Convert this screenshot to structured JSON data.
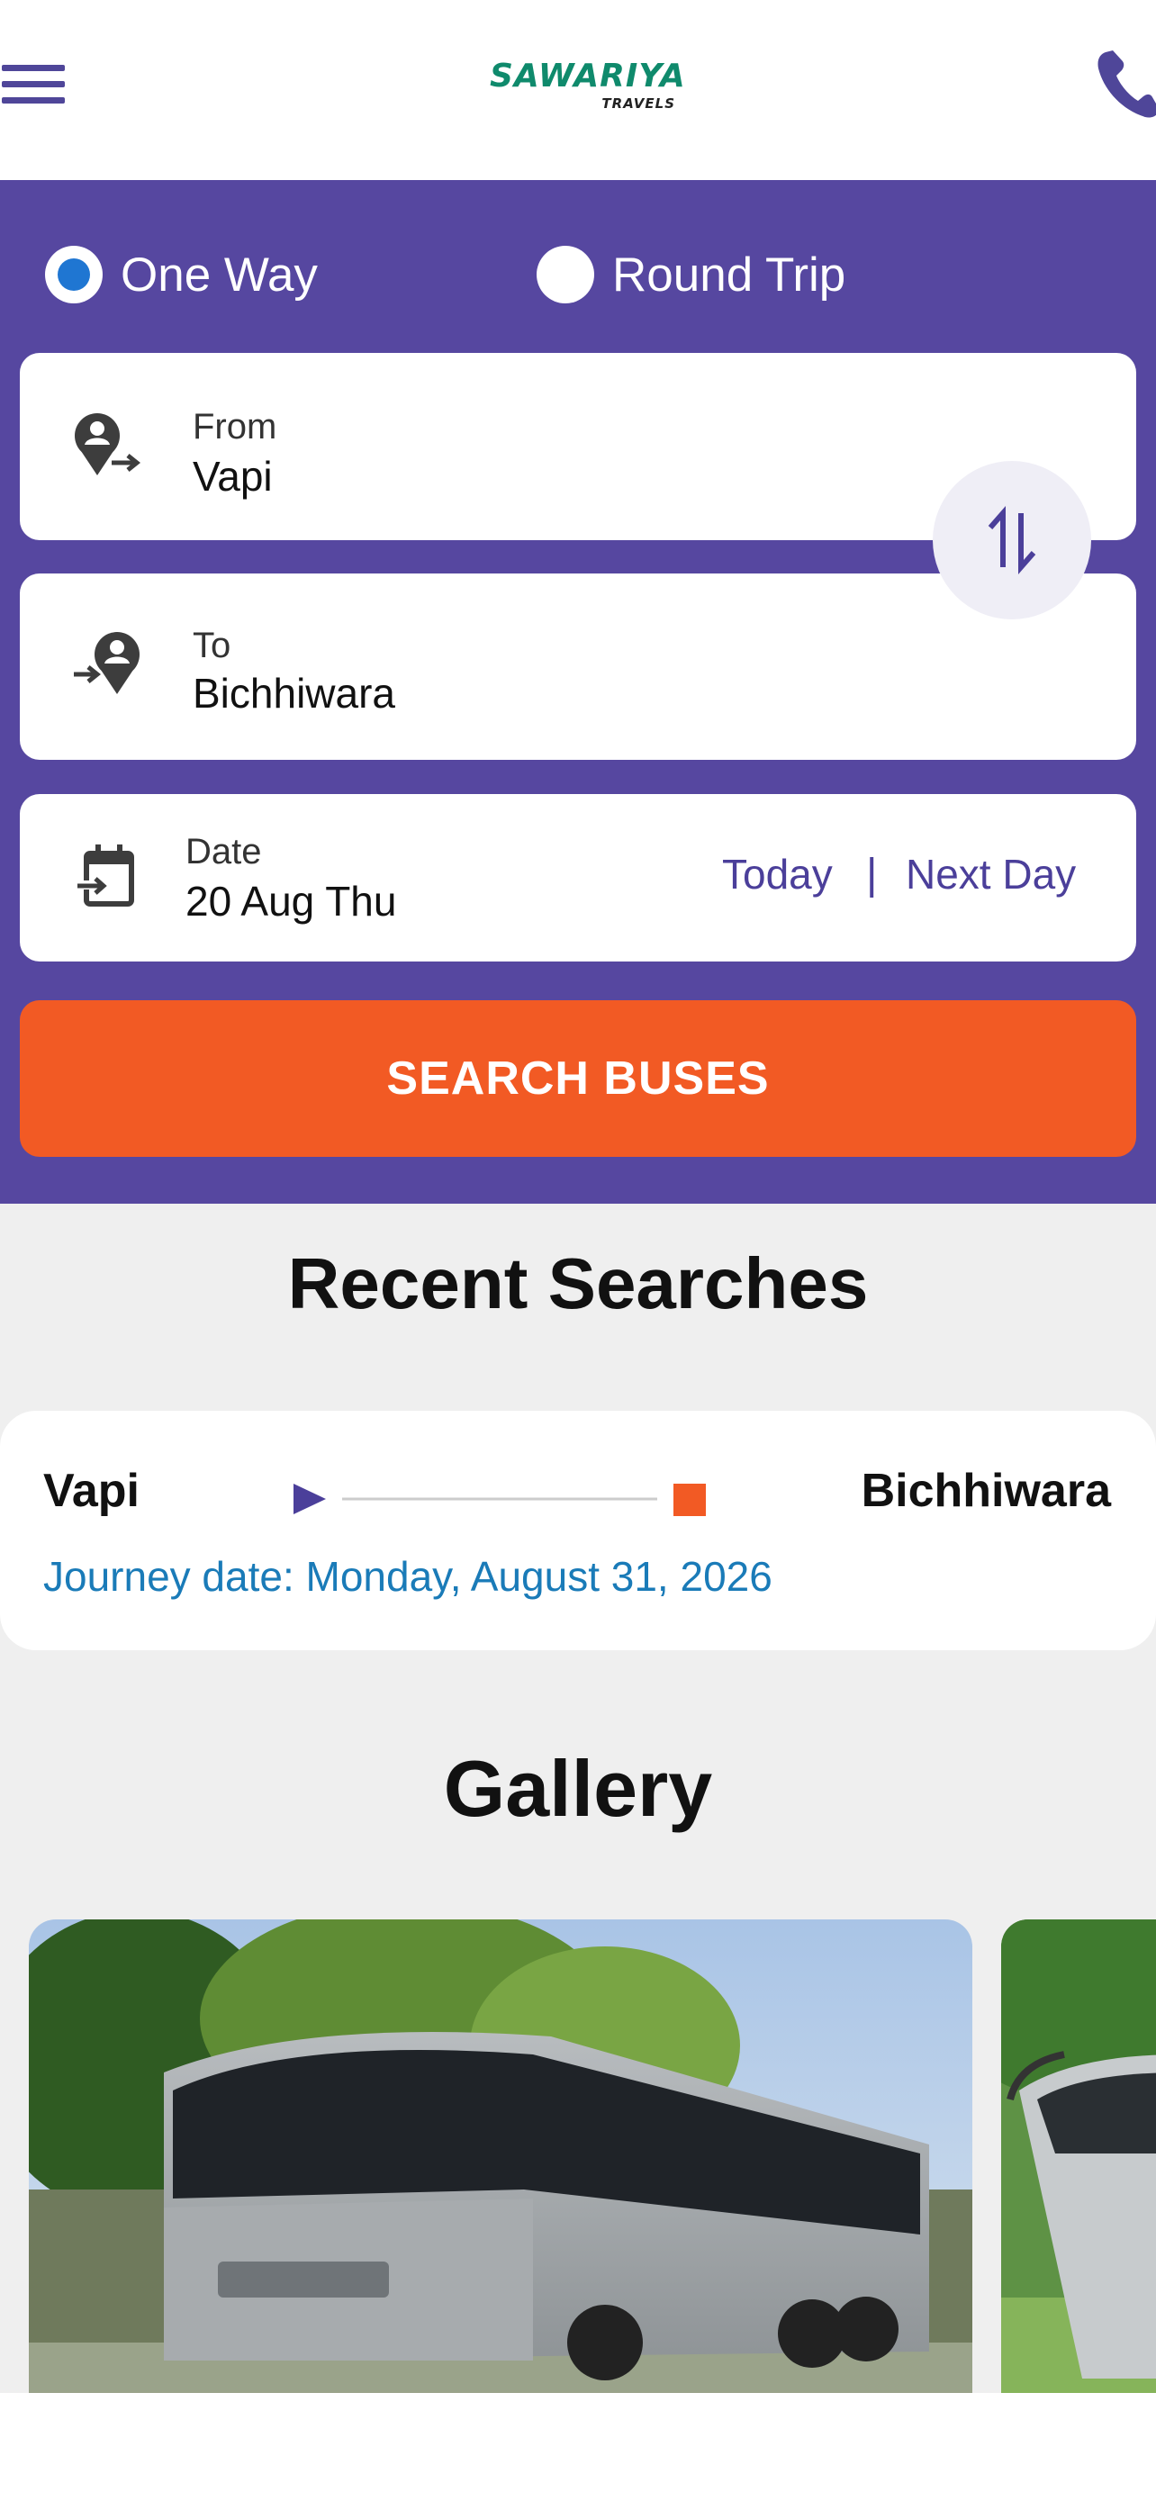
{
  "header": {
    "logo_text": "SAWARIYA",
    "logo_subtext": "TRAVELS",
    "menu_icon": "hamburger-menu-icon",
    "phone_icon": "phone-icon"
  },
  "trip_type": {
    "one_way_label": "One Way",
    "round_trip_label": "Round Trip",
    "selected": "One Way"
  },
  "from": {
    "caption": "From",
    "value": "Vapi",
    "icon": "departure-location-icon"
  },
  "to": {
    "caption": "To",
    "value": "Bichhiwara",
    "icon": "arrival-location-icon"
  },
  "swap": {
    "icon": "swap-arrows-icon"
  },
  "date": {
    "caption": "Date",
    "value": "20 Aug Thu",
    "icon": "calendar-icon",
    "today_label": "Today",
    "separator": "|",
    "next_day_label": "Next Day"
  },
  "search_button_label": "SEARCH BUSES",
  "recent": {
    "title": "Recent Searches",
    "items": [
      {
        "from": "Vapi",
        "to": "Bichhiwara",
        "journey_date": "Journey date: Monday, August 31, 2026"
      }
    ]
  },
  "gallery": {
    "title": "Gallery",
    "images": [
      "coach-bus-photo",
      "coach-bus-photo"
    ]
  },
  "colors": {
    "brand_purple": "#5647a0",
    "accent_orange": "#f25a24",
    "logo_green": "#0f8a6c",
    "radio_blue": "#1f76d2",
    "date_link_blue": "#1a7bb8"
  }
}
